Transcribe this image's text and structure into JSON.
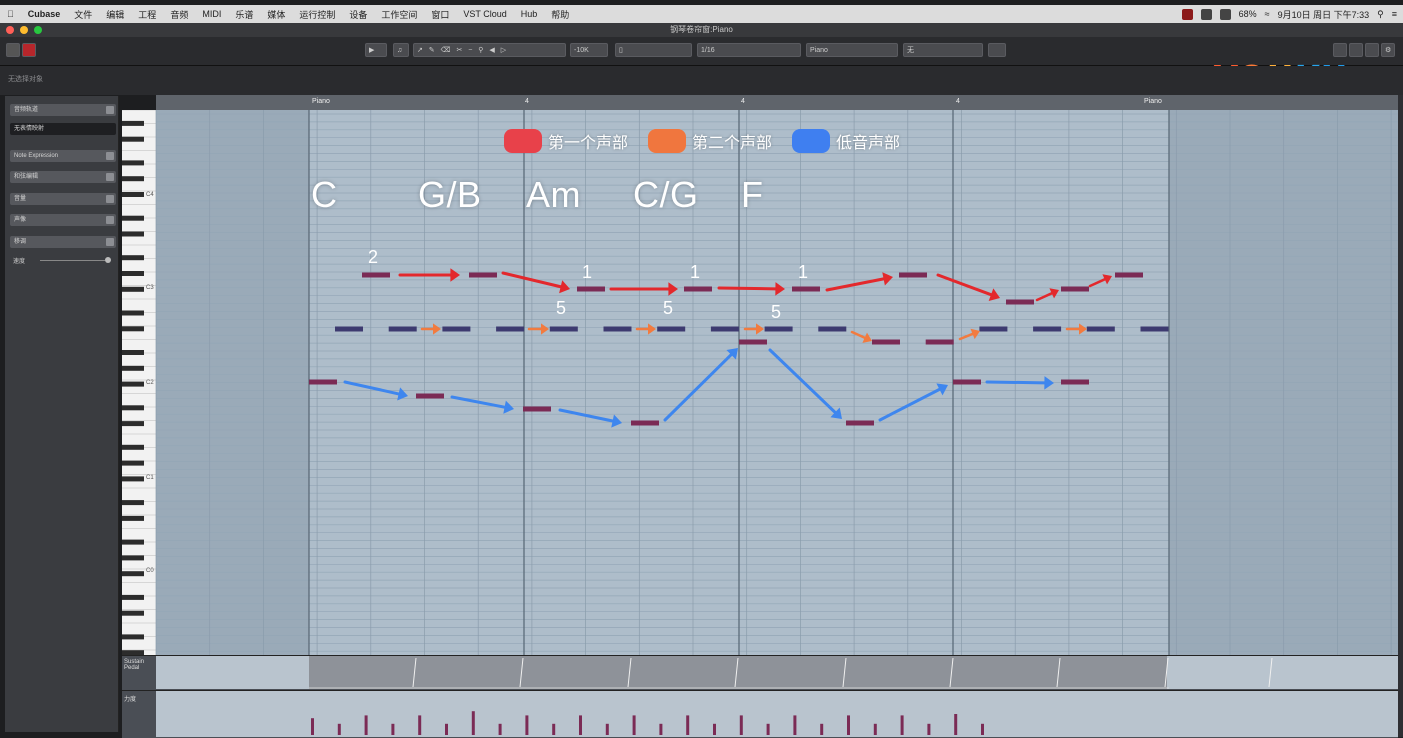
{
  "menubar": {
    "items": [
      "Cubase",
      "文件",
      "编辑",
      "工程",
      "音频",
      "MIDI",
      "乐谱",
      "媒体",
      "运行控制",
      "设备",
      "工作空间",
      "窗口",
      "VST Cloud",
      "Hub",
      "帮助"
    ],
    "battery": "68%",
    "clock": "9月10日 周日 下午7:33"
  },
  "window": {
    "title": "钢琴卷帘窗:Piano"
  },
  "toolbar": {
    "quantize": "1/16",
    "length": "1/16",
    "track": "Piano",
    "chord_track": "无",
    "zoom": "-10K"
  },
  "watermark": {
    "letters": [
      "Y",
      "O",
      "U",
      "K",
      "U"
    ]
  },
  "toolbox_title": "无选择对象",
  "inspector": {
    "rows": [
      "音频轨道",
      "无表情映射",
      "Note Expression",
      "和弦编辑",
      "音量",
      "声像",
      "移调",
      "速度"
    ]
  },
  "ruler": {
    "labels": [
      "Piano",
      "4",
      "4",
      "4",
      "Piano"
    ]
  },
  "keyboard": {
    "octave_labels": [
      "C4",
      "C3",
      "C2",
      "C1",
      "C0"
    ]
  },
  "legend": [
    {
      "label": "第一个声部",
      "color": "#e8414a"
    },
    {
      "label": "第二个声部",
      "color": "#f0763e"
    },
    {
      "label": "低音声部",
      "color": "#3f7ff0"
    }
  ],
  "chords": [
    "C",
    "G/B",
    "Am",
    "C/G",
    "F"
  ],
  "annotations": [
    "2",
    "1",
    "1",
    "1",
    "5",
    "5",
    "5"
  ],
  "lanes": {
    "lane1_label": "Sustain Pedal",
    "lane2_label": "力度"
  },
  "colors": {
    "note": "#7b2b55",
    "note_voice2": "#3d3a70",
    "arrow_red": "#e3282c",
    "arrow_orange": "#f27b3f",
    "arrow_blue": "#3e86ee",
    "grid_bg": "#aebdca"
  },
  "notes": {
    "voice1": [
      {
        "bar": 0.5,
        "pitch": "E4"
      },
      {
        "bar": 1.0,
        "pitch": "E4"
      },
      {
        "bar": 1.5,
        "pitch": "D4"
      },
      {
        "bar": 2.0,
        "pitch": "D4"
      },
      {
        "bar": 2.5,
        "pitch": "D4"
      },
      {
        "bar": 3.0,
        "pitch": "E4"
      },
      {
        "bar": 3.5,
        "pitch": "C4"
      },
      {
        "bar": 4.0,
        "pitch": "B3"
      },
      {
        "bar": 4.5,
        "pitch": "E4"
      },
      {
        "bar": 5.0,
        "pitch": "E4"
      }
    ],
    "voice2": [
      "G3",
      "G3",
      "G3",
      "G3",
      "G3",
      "G3",
      "G3",
      "G3",
      "G3",
      "G3",
      "G3",
      "G3",
      "G3",
      "G3",
      "F3",
      "F3",
      "G3",
      "G3",
      "G3",
      "G3",
      "G3"
    ],
    "bass": [
      "C3",
      "B2",
      "A2",
      "G2",
      "F3",
      "F2",
      "C3",
      "C3"
    ]
  },
  "velocity": [
    60,
    40,
    70,
    40,
    70,
    40,
    85,
    40,
    70,
    40,
    70,
    40,
    70,
    40,
    70,
    40,
    70,
    40,
    70,
    40,
    70,
    40,
    70,
    40,
    75,
    40
  ]
}
